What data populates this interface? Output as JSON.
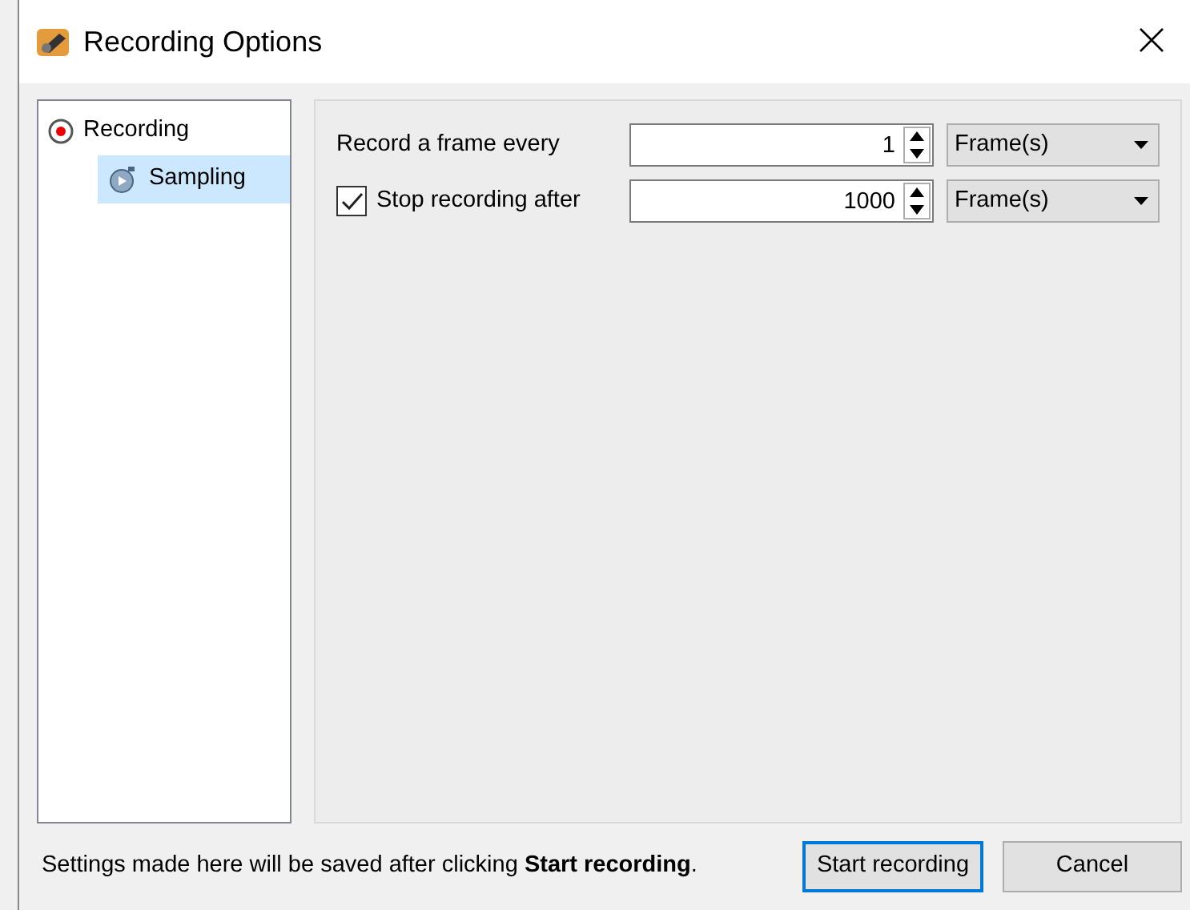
{
  "window": {
    "title": "Recording Options"
  },
  "tree": [
    {
      "label": "Recording",
      "kind": "record",
      "selected": false,
      "children": [
        {
          "label": "Sampling",
          "kind": "stopwatch",
          "selected": true
        }
      ]
    }
  ],
  "settings": [
    {
      "kind": "label",
      "label": "Record a frame every",
      "value": "1",
      "unit": "Frame(s)"
    },
    {
      "kind": "checkbox",
      "label": "Stop recording after",
      "checked": true,
      "value": "1000",
      "unit": "Frame(s)"
    }
  ],
  "footer": {
    "message": "Settings made here will be saved after clicking **Start recording**.",
    "buttons": [
      {
        "label": "Start recording",
        "default": true
      },
      {
        "label": "Cancel",
        "default": false
      }
    ]
  }
}
